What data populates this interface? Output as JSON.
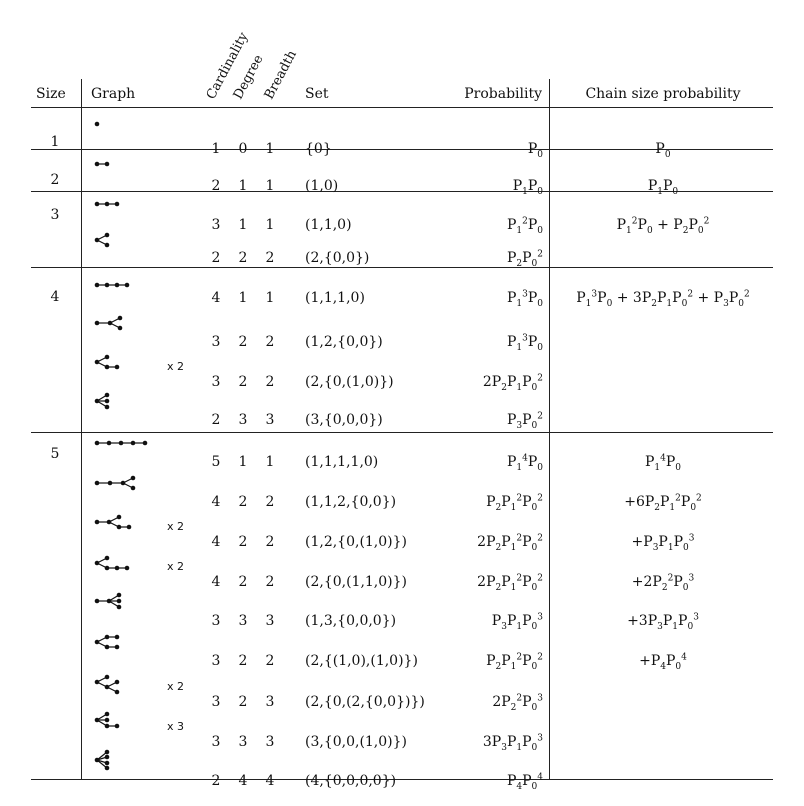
{
  "headers": {
    "size": "Size",
    "graph": "Graph",
    "cardinality": "Cardinality",
    "degree": "Degree",
    "breadth": "Breadth",
    "set": "Set",
    "probability": "Probability",
    "chain": "Chain size probability"
  },
  "sizes": [
    "1",
    "2",
    "3",
    "4",
    "5"
  ],
  "rows": [
    {
      "card": "1",
      "deg": "0",
      "br": "1",
      "set": "{0}",
      "mult": ""
    },
    {
      "card": "2",
      "deg": "1",
      "br": "1",
      "set": "(1,0)",
      "mult": ""
    },
    {
      "card": "3",
      "deg": "1",
      "br": "1",
      "set": "(1,1,0)",
      "mult": ""
    },
    {
      "card": "2",
      "deg": "2",
      "br": "2",
      "set": "(2,{0,0})",
      "mult": ""
    },
    {
      "card": "4",
      "deg": "1",
      "br": "1",
      "set": "(1,1,1,0)",
      "mult": ""
    },
    {
      "card": "3",
      "deg": "2",
      "br": "2",
      "set": "(1,2,{0,0})",
      "mult": ""
    },
    {
      "card": "3",
      "deg": "2",
      "br": "2",
      "set": "(2,{0,(1,0)})",
      "mult": "x 2"
    },
    {
      "card": "2",
      "deg": "3",
      "br": "3",
      "set": "(3,{0,0,0})",
      "mult": ""
    },
    {
      "card": "5",
      "deg": "1",
      "br": "1",
      "set": "(1,1,1,1,0)",
      "mult": ""
    },
    {
      "card": "4",
      "deg": "2",
      "br": "2",
      "set": "(1,1,2,{0,0})",
      "mult": ""
    },
    {
      "card": "4",
      "deg": "2",
      "br": "2",
      "set": "(1,2,{0,(1,0)})",
      "mult": "x 2"
    },
    {
      "card": "4",
      "deg": "2",
      "br": "2",
      "set": "(2,{0,(1,1,0)})",
      "mult": "x 2"
    },
    {
      "card": "3",
      "deg": "3",
      "br": "3",
      "set": "(1,3,{0,0,0})",
      "mult": ""
    },
    {
      "card": "3",
      "deg": "2",
      "br": "2",
      "set": "(2,{(1,0),(1,0)})",
      "mult": ""
    },
    {
      "card": "3",
      "deg": "2",
      "br": "3",
      "set": "(2,{0,(2,{0,0})})",
      "mult": "x 2"
    },
    {
      "card": "3",
      "deg": "3",
      "br": "3",
      "set": "(3,{0,0,(1,0)})",
      "mult": "x 3"
    },
    {
      "card": "2",
      "deg": "4",
      "br": "4",
      "set": "(4,{0,0,0,0})",
      "mult": ""
    }
  ],
  "probability": [
    "P<sub>0</sub>",
    "P<sub>1</sub>P<sub>0</sub>",
    "P<sub>1</sub><sup>2</sup>P<sub>0</sub>",
    "P<sub>2</sub>P<sub>0</sub><sup>2</sup>",
    "P<sub>1</sub><sup>3</sup>P<sub>0</sub>",
    "P<sub>1</sub><sup>3</sup>P<sub>0</sub>",
    "2P<sub>2</sub>P<sub>1</sub>P<sub>0</sub><sup>2</sup>",
    "P<sub>3</sub>P<sub>0</sub><sup>2</sup>",
    "P<sub>1</sub><sup>4</sup>P<sub>0</sub>",
    "P<sub>2</sub>P<sub>1</sub><sup>2</sup>P<sub>0</sub><sup>2</sup>",
    "2P<sub>2</sub>P<sub>1</sub><sup>2</sup>P<sub>0</sub><sup>2</sup>",
    "2P<sub>2</sub>P<sub>1</sub><sup>2</sup>P<sub>0</sub><sup>2</sup>",
    "P<sub>3</sub>P<sub>1</sub>P<sub>0</sub><sup>3</sup>",
    "P<sub>2</sub>P<sub>1</sub><sup>2</sup>P<sub>0</sub><sup>2</sup>",
    "2P<sub>2</sub><sup>2</sup>P<sub>0</sub><sup>3</sup>",
    "3P<sub>3</sub>P<sub>1</sub>P<sub>0</sub><sup>3</sup>",
    "P<sub>4</sub>P<sub>0</sub><sup>4</sup>"
  ],
  "chain": [
    "P<sub>0</sub>",
    "P<sub>1</sub>P<sub>0</sub>",
    "P<sub>1</sub><sup>2</sup>P<sub>0</sub> + P<sub>2</sub>P<sub>0</sub><sup>2</sup>",
    "P<sub>1</sub><sup>3</sup>P<sub>0</sub> + 3P<sub>2</sub>P<sub>1</sub>P<sub>0</sub><sup>2</sup> + P<sub>3</sub>P<sub>0</sub><sup>2</sup>",
    "P<sub>1</sub><sup>4</sup>P<sub>0</sub>",
    "+6P<sub>2</sub>P<sub>1</sub><sup>2</sup>P<sub>0</sub><sup>2</sup>",
    "+P<sub>3</sub>P<sub>1</sub>P<sub>0</sub><sup>3</sup>",
    "+2P<sub>2</sub><sup>2</sup>P<sub>0</sub><sup>3</sup>",
    "+3P<sub>3</sub>P<sub>1</sub>P<sub>0</sub><sup>3</sup>",
    "+P<sub>4</sub>P<sub>0</sub><sup>4</sup>"
  ]
}
